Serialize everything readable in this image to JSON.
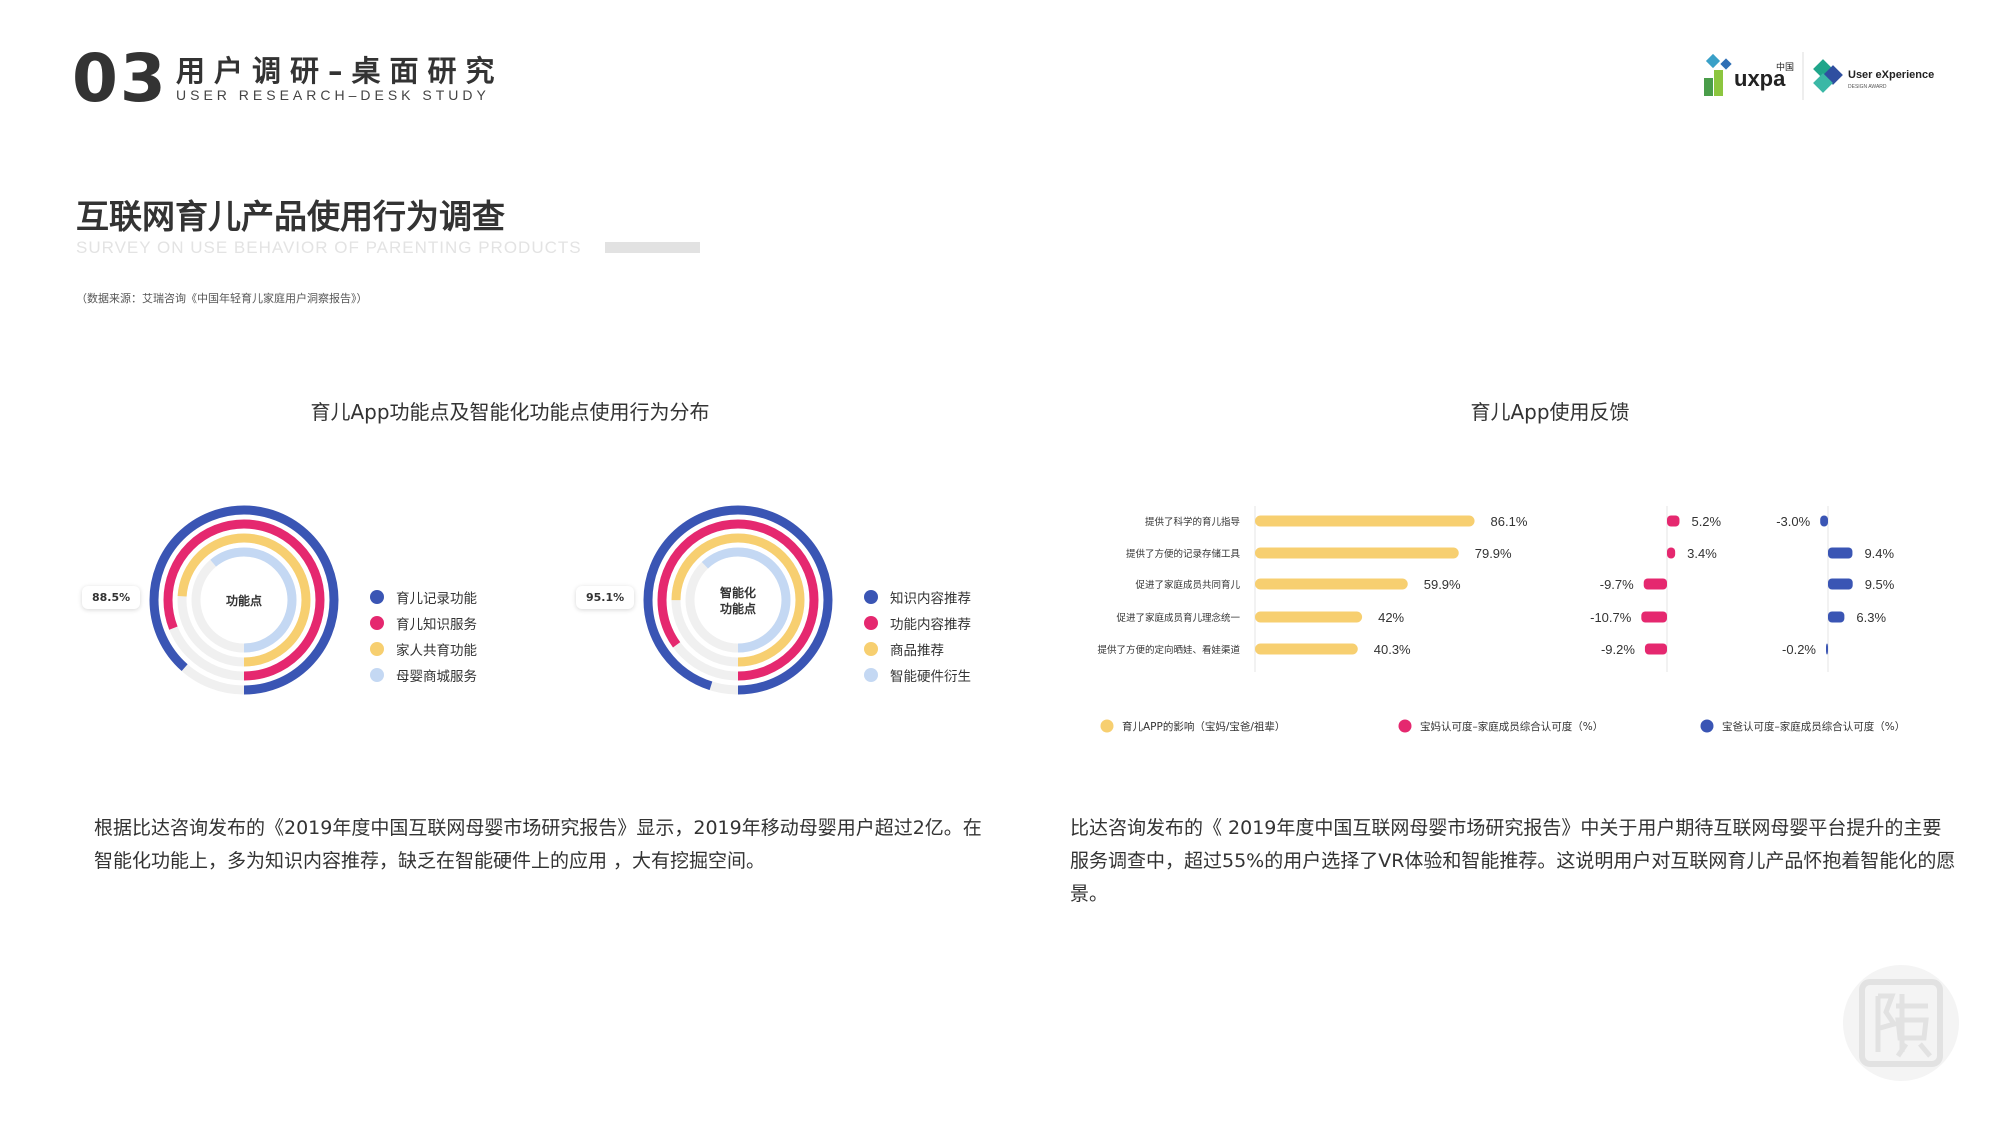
{
  "header": {
    "section_number": "03",
    "section_title": "用户调研–桌面研究",
    "section_subtitle": "USER RESEARCH–DESK STUDY",
    "logos": {
      "uxpa": "uxpa",
      "uxpa_cn": "中国",
      "ued": "User eXperience",
      "ued_sub": "DESIGN AWARD"
    }
  },
  "page": {
    "title": "互联网育儿产品使用行为调查",
    "subtitle": "SURVEY ON USE BEHAVIOR OF PARENTING PRODUCTS",
    "source": "（数据来源：艾瑞咨询《中国年轻育儿家庭用户洞察报告》）"
  },
  "colors": {
    "blue": "#3a55b4",
    "pink": "#e5286f",
    "yellow": "#f7cf70",
    "light_blue": "#c4d8f3",
    "track": "#f0f0f0"
  },
  "left_chart": {
    "title": "育儿App功能点及智能化功能点使用行为分布"
  },
  "right_chart": {
    "title": "育儿App使用反馈"
  },
  "chart_data": [
    {
      "type": "radial-bar",
      "center_label": "功能点",
      "badge": "88.5%",
      "categories": [
        "育儿记录功能",
        "育儿知识服务",
        "家人共育功能",
        "母婴商城服务"
      ],
      "values": [
        88.5,
        81,
        74,
        61
      ]
    },
    {
      "type": "radial-bar",
      "center_label": "智能化\n功能点",
      "badge": "95.1%",
      "categories": [
        "知识内容推荐",
        "功能内容推荐",
        "商品推荐",
        "智能硬件衍生"
      ],
      "values": [
        95.1,
        85,
        75,
        62
      ]
    },
    {
      "type": "bar",
      "orientation": "horizontal",
      "categories": [
        "提供了科学的育儿指导",
        "提供了方便的记录存储工具",
        "促进了家庭成员共同育儿",
        "促进了家庭成员育儿理念统一",
        "提供了方便的定向晒娃、看娃渠道"
      ],
      "series": [
        {
          "name": "育儿APP的影响（宝妈/宝爸/祖辈）",
          "values": [
            86.1,
            79.9,
            59.9,
            42,
            40.3
          ],
          "labels": [
            "86.1%",
            "79.9%",
            "59.9%",
            "42%",
            "40.3%"
          ],
          "color": "#f7cf70"
        },
        {
          "name": "宝妈认可度–家庭成员综合认可度（%）",
          "values": [
            5.2,
            3.4,
            -9.7,
            -10.7,
            -9.2
          ],
          "labels": [
            "5.2%",
            "3.4%",
            "-9.7%",
            "-10.7%",
            "-9.2%"
          ],
          "color": "#e5286f"
        },
        {
          "name": "宝爸认可度–家庭成员综合认可度（%）",
          "values": [
            -3.0,
            9.4,
            9.5,
            6.3,
            -0.2
          ],
          "labels": [
            "-3.0%",
            "9.4%",
            "9.5%",
            "6.3%",
            "-0.2%"
          ],
          "color": "#3a55b4"
        }
      ]
    }
  ],
  "paragraphs": {
    "left": "根据比达咨询发布的《2019年度中国互联网母婴市场研究报告》显示，2019年移动母婴用户超过2亿。在智能化功能上，多为知识内容推荐，缺乏在智能硬件上的应用 ，大有挖掘空间。",
    "right": "比达咨询发布的《 2019年度中国互联网母婴市场研究报告》中关于用户期待互联网母婴平台提升的主要服务调查中，超过55%的用户选择了VR体验和智能推荐。这说明用户对互联网育儿产品怀抱着智能化的愿景。"
  }
}
